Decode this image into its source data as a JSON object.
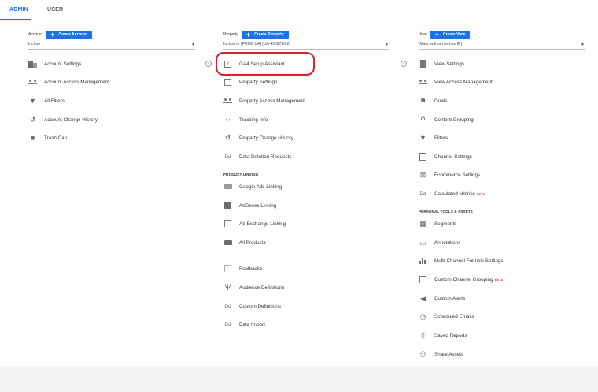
{
  "tabs": {
    "admin": "ADMIN",
    "user": "USER"
  },
  "account": {
    "label": "Account",
    "create_label": "Create Account",
    "selected": "Inchoo",
    "items": [
      {
        "label": "Account Settings",
        "icon": "building-icon"
      },
      {
        "label": "Account Access Management",
        "icon": "people-icon"
      },
      {
        "label": "All Filters",
        "icon": "filter-icon"
      },
      {
        "label": "Account Change History",
        "icon": "history-icon"
      },
      {
        "label": "Trash Can",
        "icon": "trash-icon"
      }
    ]
  },
  "property": {
    "label": "Property",
    "create_label": "Create Property",
    "selected": "Inchoo.hr [PROD UA] (UA-4508756-2)",
    "items": [
      {
        "label": "GA4 Setup Assistant",
        "icon": "checkbox-icon"
      },
      {
        "label": "Property Settings",
        "icon": "settings-window-icon"
      },
      {
        "label": "Property Access Management",
        "icon": "people-icon"
      },
      {
        "label": "Tracking Info",
        "icon": "code-icon"
      },
      {
        "label": "Property Change History",
        "icon": "history-icon"
      },
      {
        "label": "Data Deletion Requests",
        "icon": "dd-icon"
      }
    ],
    "section_title": "PRODUCT LINKING",
    "linking_items": [
      {
        "label": "Google Ads Linking",
        "icon": "ads-icon"
      },
      {
        "label": "AdSense Linking",
        "icon": "adsense-icon"
      },
      {
        "label": "Ad Exchange Linking",
        "icon": "adexchange-icon"
      },
      {
        "label": "All Products",
        "icon": "products-icon"
      }
    ],
    "other_items": [
      {
        "label": "Postbacks",
        "icon": "postbacks-icon"
      },
      {
        "label": "Audience Definitions",
        "icon": "audience-icon"
      },
      {
        "label": "Custom Definitions",
        "icon": "dd-icon"
      },
      {
        "label": "Data Import",
        "icon": "dd-icon"
      }
    ]
  },
  "view": {
    "label": "View",
    "create_label": "Create View",
    "selected": "[Main, without Inchoo IP]",
    "items": [
      {
        "label": "View Settings",
        "icon": "document-icon"
      },
      {
        "label": "View Access Management",
        "icon": "people-icon"
      },
      {
        "label": "Goals",
        "icon": "flag-icon"
      },
      {
        "label": "Content Grouping",
        "icon": "person-icon"
      },
      {
        "label": "Filters",
        "icon": "filter-icon"
      },
      {
        "label": "Channel Settings",
        "icon": "channel-icon"
      },
      {
        "label": "Ecommerce Settings",
        "icon": "cart-icon"
      },
      {
        "label": "Calculated Metrics",
        "icon": "dd-icon",
        "badge": "BETA"
      }
    ],
    "section_title": "PERSONAL TOOLS & ASSETS",
    "personal_items": [
      {
        "label": "Segments",
        "icon": "segments-icon"
      },
      {
        "label": "Annotations",
        "icon": "annotation-icon"
      },
      {
        "label": "Multi-Channel Funnels Settings",
        "icon": "bar-chart-icon"
      },
      {
        "label": "Custom Channel Grouping",
        "icon": "channel-icon",
        "badge": "BETA"
      },
      {
        "label": "Custom Alerts",
        "icon": "megaphone-icon"
      },
      {
        "label": "Scheduled Emails",
        "icon": "clock-icon"
      },
      {
        "label": "Saved Reports",
        "icon": "saved-report-icon"
      },
      {
        "label": "Share Assets",
        "icon": "share-people-icon"
      }
    ]
  },
  "glyphs": {
    "plus": "+",
    "caret": "▼",
    "collapse": "‹",
    "filter": "▼",
    "history": "↺",
    "trash": "■",
    "check": "✓",
    "code": "‹ ›",
    "dd": "Dd",
    "audience": "Ψ",
    "flag": "⚑",
    "person": "⚲",
    "cart": "⊠",
    "segments": "▦",
    "annotation": "▭",
    "bar_chart": "▮",
    "megaphone": "◀",
    "clock": "◷",
    "saved_report": "▯",
    "share": "⚇"
  }
}
